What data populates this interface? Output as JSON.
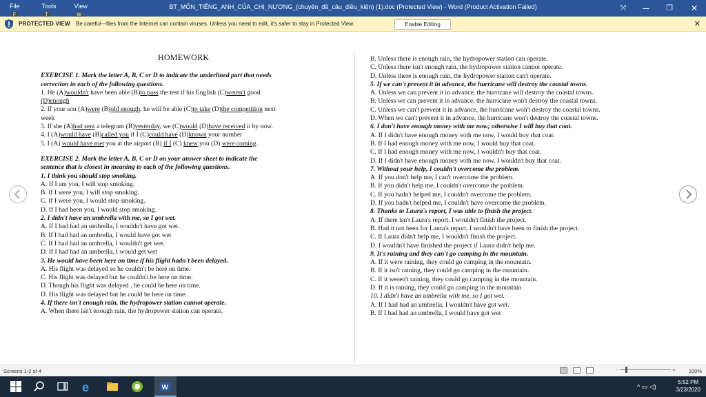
{
  "titlebar": {
    "menu": [
      {
        "label": "File",
        "keytip": "F"
      },
      {
        "label": "Tools",
        "keytip": "T"
      },
      {
        "label": "View",
        "keytip": "W"
      }
    ],
    "title": "BT_MÔN_TIẾNG_ANH_CỦA_CHỊ_NƯƠNG_(chuyên_đề_câu_điều_kiện) (1).doc (Protected View) - Word (Product Activation Failed)",
    "buttons": {
      "focus": "⤧",
      "minimize": "—",
      "restore": "❐",
      "close": "✕"
    }
  },
  "protected_view": {
    "label": "PROTECTED VIEW",
    "message": "Be careful—files from the Internet can contain viruses. Unless you need to edit, it's safer to stay in Protected View.",
    "enable_button": "Enable Editing",
    "close": "✕"
  },
  "document": {
    "left": {
      "heading": "HOMEWORK",
      "ex1_title1": "EXERCISE 1. Mark the letter A, B, C or D to indicate the underlined part that needs",
      "ex1_title2": "correction in each of the following questions.",
      "q1": {
        "a": "1. He (A)",
        "b": "wouldn't",
        "c": " have been able (B)",
        "d": "to pass",
        "e": " the test if his English (C)",
        "f": "weren't",
        "g": " good",
        "h": "(D)",
        "i": "enough"
      },
      "q2": {
        "a": "2. If your son (A)",
        "b": "were",
        "c": " (B)",
        "d": "old enough",
        "e": ", he will be able (C)",
        "f": "to take",
        "g": " (D)",
        "h": "the competition",
        "i": " next",
        "j": "week"
      },
      "q3": {
        "a": "3. If she (A)",
        "b": "had sent",
        "c": " a telegram (B)",
        "d": "yesterday",
        "e": ", we (C)",
        "f": "would",
        "g": " (D)",
        "h": "have received",
        "i": " it by now."
      },
      "q4": {
        "a": "4. I (A)",
        "b": "would have",
        "c": " (B)",
        "d": "called you",
        "e": " if I (C)",
        "f": "could have",
        "g": " (D)",
        "h": "known",
        "i": " your number"
      },
      "q5": {
        "a": "5. I (A) ",
        "b": "would have met",
        "c": " you at the airport (B) ",
        "d": "if I",
        "e": " (C) ",
        "f": "knew",
        "g": " you (D) ",
        "h": "were coming",
        "i": "."
      },
      "ex2_title1": "EXERCISE 2. Mark the letter A, B, C or D on your answer sheet to indicate the",
      "ex2_title2": "sentence that is closest in meaning to each of the following questions.",
      "lines": [
        {
          "t": "1. I think you should stop smoking.",
          "s": "bi"
        },
        {
          "t": "A. If I am you, I will stop smoking.",
          "s": ""
        },
        {
          "t": "B. If I were you, I will stop smoking.",
          "s": ""
        },
        {
          "t": "C. If I were you, I would stop smoking.",
          "s": ""
        },
        {
          "t": "D. If I had been you, I would stop smoking.",
          "s": ""
        },
        {
          "t": "2. I didn't have an umbrella with me, so I got wet.",
          "s": "bi"
        },
        {
          "t": "A. If I had had an umbrella, I wouldn't have got wet.",
          "s": ""
        },
        {
          "t": "B. If I had had an umbrella, I would have got wet",
          "s": ""
        },
        {
          "t": "C. If I had had an umbrella, I wouldn't get wet.",
          "s": ""
        },
        {
          "t": "D. If I had had an umbrella, I would get wet",
          "s": ""
        },
        {
          "t": "3. He would have been here on time if his flight hadn't been delayed.",
          "s": "bi"
        },
        {
          "t": "A. His flight was delayed so he couldn't be here on time.",
          "s": ""
        },
        {
          "t": "C. His flight was delayed but he couldn't be here on time.",
          "s": ""
        },
        {
          "t": "D. Though his flight was delayed , he could be here on time.",
          "s": ""
        },
        {
          "t": "D. His flight was delayed but he could be here on time.",
          "s": ""
        },
        {
          "t": "4. If there isn't enough rain, the hydropower station cannot operate.",
          "s": "bi"
        },
        {
          "t": "A. When there isn't enough rain, the hydropower station can operate.",
          "s": ""
        }
      ]
    },
    "right": {
      "lines": [
        {
          "t": "B. Unless there is enough rain, the hydropower station can operate.",
          "s": ""
        },
        {
          "t": "C. Unless there isn't enough rain, the hydropower station cannot operate.",
          "s": ""
        },
        {
          "t": "D. Unless there is enough rain, the hydropower station can't operate.",
          "s": ""
        },
        {
          "t": "5. If we can't prevent it in advance, the hurricane will destroy the coastal towns.",
          "s": "bi"
        },
        {
          "t": "A. Unless we can prevent it in advance, the hurricane will destroy the coastal towns.",
          "s": ""
        },
        {
          "t": "B. Unless we can prevent it in advance, the hurricane won't destroy the coastal towns.",
          "s": ""
        },
        {
          "t": "C. Unless we can't prevent it in advance, the hurricane won't destroy the coastal towns.",
          "s": ""
        },
        {
          "t": "D. When we can't prevent it in advance, the hurricane won't destroy the coastal towns.",
          "s": ""
        },
        {
          "t": "6. I don't have enough money with me now; otherwise I will buy that coat.",
          "s": "bi"
        },
        {
          "t": "A. If I didn't have enough money with me now, I would buy that coat.",
          "s": ""
        },
        {
          "t": "B. If I had enough money with me now, I would buy that coat.",
          "s": ""
        },
        {
          "t": "C. If I had enough money with me now, I wouldn't buy that coat.",
          "s": ""
        },
        {
          "t": "D. If I didn't have enough money with me now, I wouldn't buy that coat.",
          "s": ""
        },
        {
          "t": "7. Without your help, I couldn't overcome the problem.",
          "s": "bi"
        },
        {
          "t": "A. If you don't help me, I can't overcome the problem.",
          "s": ""
        },
        {
          "t": "B. If you didn't help me, I couldn't overcome the problem.",
          "s": ""
        },
        {
          "t": "C. If you hadn't helped me, I couldn't overcome the problem.",
          "s": ""
        },
        {
          "t": "D. If you hadn't helped me, I couldn't have overcome the problem.",
          "s": ""
        },
        {
          "t": "8. Thanks to Laura's report, I was able to finish the project.",
          "s": "bi"
        },
        {
          "t": "A. If there isn't Laura's report, I wouldn't finish the project.",
          "s": ""
        },
        {
          "t": "B. Had it not been for Laura's report, I wouldn't have been to finish the project.",
          "s": ""
        },
        {
          "t": "C. If Laura didn't help me, I wouldn't finish the project.",
          "s": ""
        },
        {
          "t": "D. I wouldn't have finished the project if Laura didn't help me.",
          "s": ""
        },
        {
          "t": "9. It's raining and they can't go camping in the mountain.",
          "s": "bi"
        },
        {
          "t": "A. If it were raining, they could go camping in the mountain.",
          "s": ""
        },
        {
          "t": "B. If it isn't raining, they could go camping in the mountain.",
          "s": ""
        },
        {
          "t": "C. If it weren't raining, they could go camping in the mountain.",
          "s": ""
        },
        {
          "t": "D. If it is raining, they could go camping in the mountain",
          "s": ""
        },
        {
          "t": "10. I didn't have an umbrella with me, so I got wet.",
          "s": "it"
        },
        {
          "t": "A. If I had had an umbrella, I wouldn't have got wet.",
          "s": ""
        },
        {
          "t": "B. If I had had an umbrella, I would have got wet",
          "s": ""
        }
      ]
    }
  },
  "statusbar": {
    "screens": "Screens 1-2 of 4",
    "zoom": "100%",
    "zoom_minus": "-",
    "zoom_plus": "+"
  },
  "taskbar": {
    "time": "5:52 PM",
    "date": "3/23/2020"
  }
}
